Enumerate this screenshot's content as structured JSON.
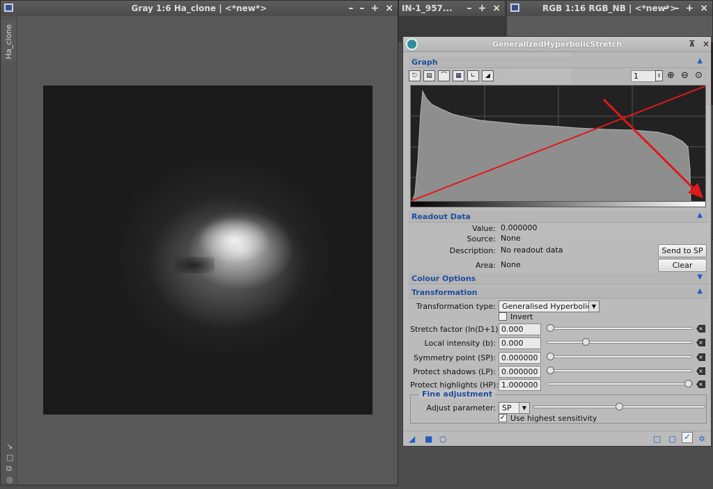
{
  "windows": {
    "ha": {
      "title": "Gray 1:6 Ha_clone | <*new*>",
      "side_tab": "Ha_clone",
      "controls": [
        "–",
        "–",
        "+",
        "×"
      ]
    },
    "mid": {
      "title": "IN-1_957...",
      "controls": [
        "–",
        "+",
        "×"
      ]
    },
    "rgb": {
      "title": "RGB 1:16 RGB_NB | <*new*>",
      "controls": [
        "–",
        "–",
        "+",
        "×"
      ]
    }
  },
  "ghs": {
    "title": "GeneralizedHyperbolicStretch",
    "graph": {
      "section_label": "Graph",
      "zoom_value": "1",
      "toolbar_icons": [
        "histogram-icon",
        "log-histogram-icon",
        "curve-icon",
        "grid-icon",
        "stretch-icon",
        "linear-icon"
      ]
    },
    "readout": {
      "section_label": "Readout Data",
      "value_label": "Value:",
      "value": "0.000000",
      "source_label": "Source:",
      "source": "None",
      "description_label": "Description:",
      "description": "No readout data",
      "area_label": "Area:",
      "area": "None",
      "send_button": "Send to SP",
      "clear_button": "Clear"
    },
    "colour": {
      "section_label": "Colour Options"
    },
    "transformation": {
      "section_label": "Transformation",
      "type_label": "Transformation type:",
      "type_value": "Generalised Hyperbolic",
      "invert_label": "Invert",
      "invert_checked": false,
      "params": [
        {
          "label": "Stretch factor (ln(D+1)):",
          "value": "0.000",
          "level": 0.0
        },
        {
          "label": "Local intensity (b):",
          "value": "0.000",
          "level": 0.26
        },
        {
          "label": "Symmetry point (SP):",
          "value": "0.000000",
          "level": 0.0
        },
        {
          "label": "Protect shadows (LP):",
          "value": "0.000000",
          "level": 0.0
        },
        {
          "label": "Protect highlights (HP):",
          "value": "1.000000",
          "level": 1.0
        }
      ]
    },
    "fine": {
      "group_label": "Fine adjustment",
      "adjust_label": "Adjust parameter:",
      "adjust_value": "SP",
      "adjust_level": 0.5,
      "sensitivity_label": "Use highest sensitivity",
      "sensitivity_checked": true
    }
  },
  "colors": {
    "accent": "#1f5fc0",
    "section_text": "#1f4e9e",
    "annotation": "#e01818"
  }
}
